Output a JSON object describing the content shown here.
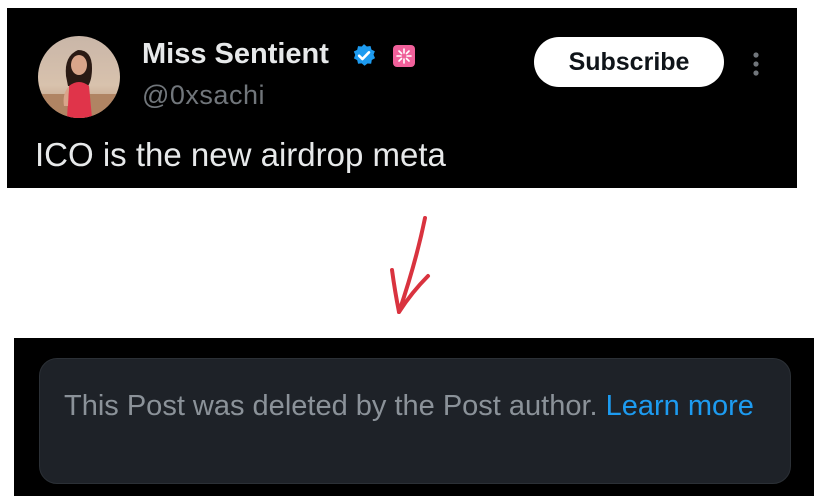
{
  "tweet": {
    "display_name": "Miss Sentient",
    "handle": "@0xsachi",
    "subscribe_label": "Subscribe",
    "text": "ICO is the new airdrop meta",
    "icons": [
      "verified-icon",
      "affiliate-badge-icon",
      "more-options-icon"
    ]
  },
  "deleted_notice": {
    "message": "This Post was deleted by the Post author. ",
    "link_label": "Learn more"
  },
  "colors": {
    "card_background": "#000000",
    "primary_text": "#e7e9ea",
    "secondary_text": "#71767b",
    "link": "#1d9bf0",
    "verified": "#1d9bf0",
    "affiliate_badge": "#f0609a",
    "arrow": "#d9333f"
  }
}
